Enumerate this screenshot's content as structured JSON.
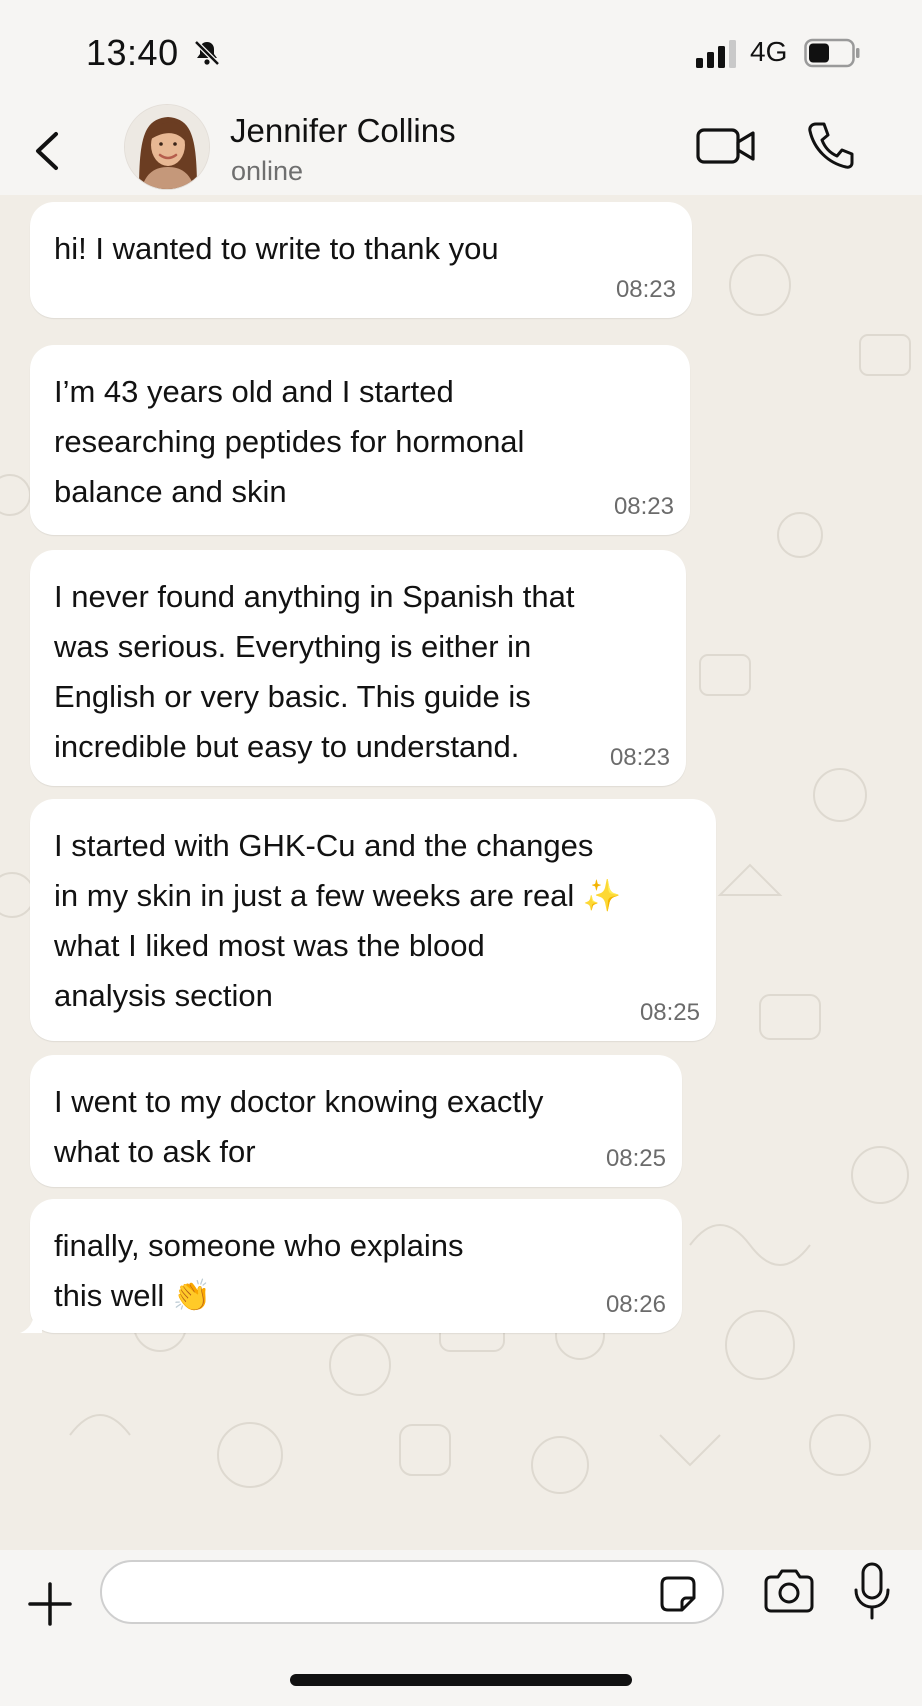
{
  "status_bar": {
    "time": "13:40",
    "network": "4G",
    "icons": [
      "bell-muted-icon",
      "signal-icon",
      "battery-icon"
    ]
  },
  "header": {
    "contact_name": "Jennifer Collins",
    "contact_status": "online",
    "icons": [
      "back-chevron-icon",
      "avatar",
      "video-call-icon",
      "phone-call-icon"
    ]
  },
  "messages": [
    {
      "text": "hi! I wanted to write to thank you",
      "time": "08:23"
    },
    {
      "text": "I’m 43 years old and I started\nresearching peptides for hormonal\nbalance and skin",
      "time": "08:23"
    },
    {
      "text": "I never found anything in Spanish that\nwas serious. Everything is either in\nEnglish or very basic. This guide is\nincredible but easy to understand.",
      "time": "08:23"
    },
    {
      "text": "I started with GHK-Cu and the changes\nin my skin in just a few weeks are real ✨\nwhat I liked most was the blood\nanalysis section",
      "time": "08:25"
    },
    {
      "text": "I went to my doctor knowing exactly\nwhat to ask for",
      "time": "08:25"
    },
    {
      "text": "finally, someone who explains\nthis well 👏",
      "time": "08:26"
    }
  ],
  "composer": {
    "input_value": "",
    "icons": [
      "plus-icon",
      "sticker-icon",
      "camera-icon",
      "microphone-icon"
    ]
  },
  "colors": {
    "chat_background": "#f1ede6",
    "bubble": "#ffffff",
    "header_background": "#f6f5f3",
    "timestamp": "#6b6b6b"
  }
}
